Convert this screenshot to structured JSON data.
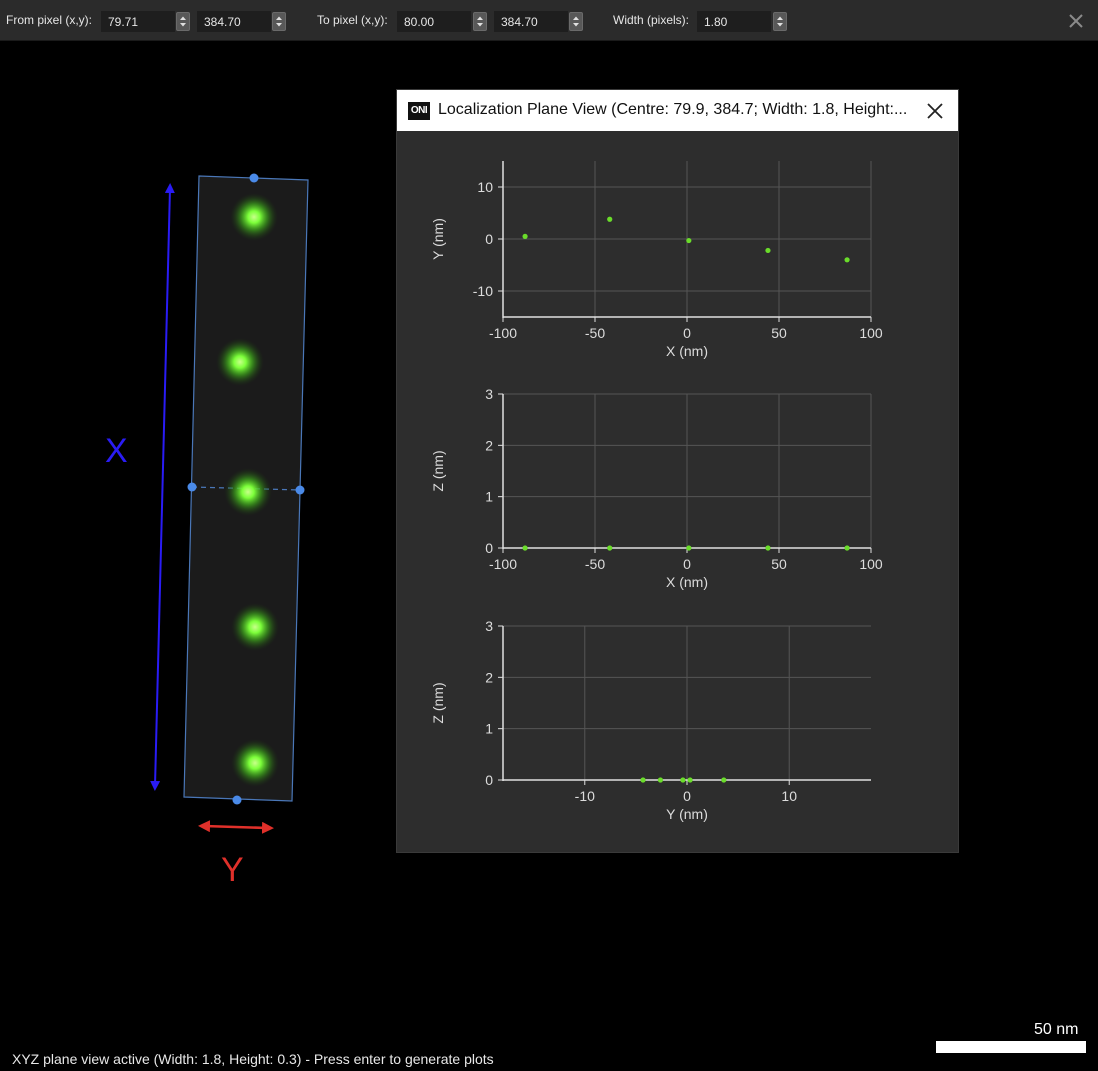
{
  "toolbar": {
    "from_label": "From pixel (x,y):",
    "from_x": "79.71",
    "from_y": "384.70",
    "to_label": "To pixel (x,y):",
    "to_x": "80.00",
    "to_y": "384.70",
    "width_label": "Width (pixels):",
    "width_value": "1.80"
  },
  "labels": {
    "x_axis_letter": "X",
    "y_axis_letter": "Y"
  },
  "colors": {
    "x_arrow": "#2a1cf5",
    "y_arrow": "#e0302a",
    "spot": "#7cff3a",
    "plot_point": "#6adc2a"
  },
  "window": {
    "logo": "ONI",
    "title": "Localization Plane View (Centre: 79.9, 384.7; Width: 1.8, Height:..."
  },
  "status": "XYZ plane view active (Width: 1.8, Height: 0.3) - Press enter to generate plots",
  "scalebar": {
    "label": "50 nm"
  },
  "chart_data": [
    {
      "type": "scatter",
      "xlabel": "X (nm)",
      "ylabel": "Y (nm)",
      "xlim": [
        -100,
        100
      ],
      "ylim": [
        -15,
        15
      ],
      "xticks": [
        -100,
        -50,
        0,
        50,
        100
      ],
      "yticks": [
        10,
        0,
        -10
      ],
      "grid": true,
      "points": [
        {
          "x": -88,
          "y": 0.5
        },
        {
          "x": -42,
          "y": 3.8
        },
        {
          "x": 1,
          "y": -0.3
        },
        {
          "x": 44,
          "y": -2.2
        },
        {
          "x": 87,
          "y": -4.0
        }
      ]
    },
    {
      "type": "scatter",
      "xlabel": "X (nm)",
      "ylabel": "Z (nm)",
      "xlim": [
        -100,
        100
      ],
      "ylim": [
        0,
        3
      ],
      "xticks": [
        -100,
        -50,
        0,
        50,
        100
      ],
      "yticks": [
        3,
        2,
        1,
        0
      ],
      "grid": true,
      "points": [
        {
          "x": -88,
          "y": 0
        },
        {
          "x": -42,
          "y": 0
        },
        {
          "x": 1,
          "y": 0
        },
        {
          "x": 44,
          "y": 0
        },
        {
          "x": 87,
          "y": 0
        }
      ]
    },
    {
      "type": "scatter",
      "xlabel": "Y (nm)",
      "ylabel": "Z (nm)",
      "xlim": [
        -18,
        18
      ],
      "ylim": [
        0,
        3
      ],
      "xticks": [
        -10,
        0,
        10
      ],
      "yticks": [
        3,
        2,
        1,
        0
      ],
      "grid": true,
      "points": [
        {
          "x": -4.3,
          "y": 0
        },
        {
          "x": -2.6,
          "y": 0
        },
        {
          "x": -0.4,
          "y": 0
        },
        {
          "x": 0.3,
          "y": 0
        },
        {
          "x": 3.6,
          "y": 0
        }
      ]
    }
  ]
}
